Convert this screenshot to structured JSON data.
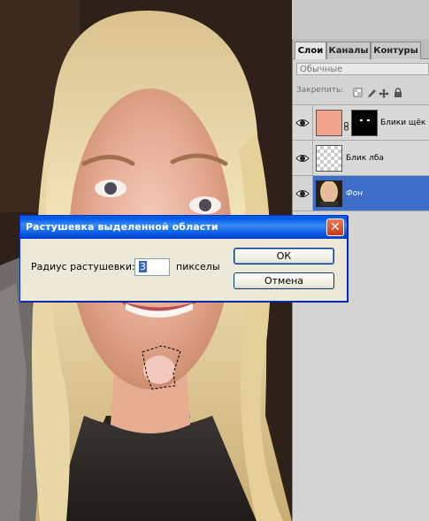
{
  "photo": {
    "subject": "portrait-photo"
  },
  "layers_panel": {
    "tabs": [
      {
        "label": "Слои",
        "active": true
      },
      {
        "label": "Каналы",
        "active": false
      },
      {
        "label": "Контуры",
        "active": false
      }
    ],
    "blend_mode": "Обычные",
    "lock_label": "Закрепить:",
    "layers": [
      {
        "name": "Блики щёк",
        "visible": true,
        "selected": false,
        "has_mask": true,
        "thumb_color": "#f2a58e"
      },
      {
        "name": "Блик лба",
        "visible": true,
        "selected": false,
        "has_mask": false
      },
      {
        "name": "Фон",
        "visible": true,
        "selected": true,
        "has_mask": false
      }
    ],
    "selected_color": "#3d6dc7"
  },
  "dialog": {
    "title": "Растушевка выделенной области",
    "radius_label": "Радиус растушевки:",
    "radius_value": "3",
    "units_label": "пикселы",
    "ok_label": "ОК",
    "cancel_label": "Отмена"
  }
}
